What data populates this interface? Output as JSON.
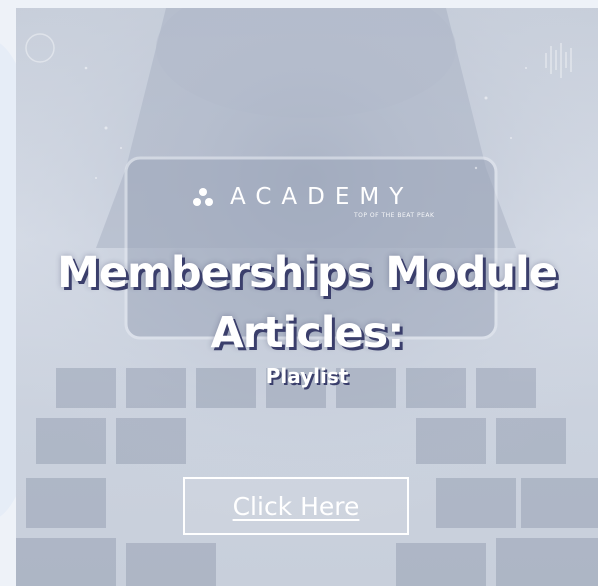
{
  "banner": {
    "brand_name": "ACADEMY",
    "brand_tagline": "TOP OF THE BEAT PEAK",
    "title_line_1": "Memberships Module",
    "title_line_2": "Articles:",
    "subtitle": "Playlist",
    "cta_label": "Click Here"
  },
  "colors": {
    "text": "#ffffff",
    "title_shadow": "#3a3e6b",
    "card_bg": "#cfd6e2"
  },
  "icons": {
    "brand_logo": "academy-logo-icon"
  }
}
